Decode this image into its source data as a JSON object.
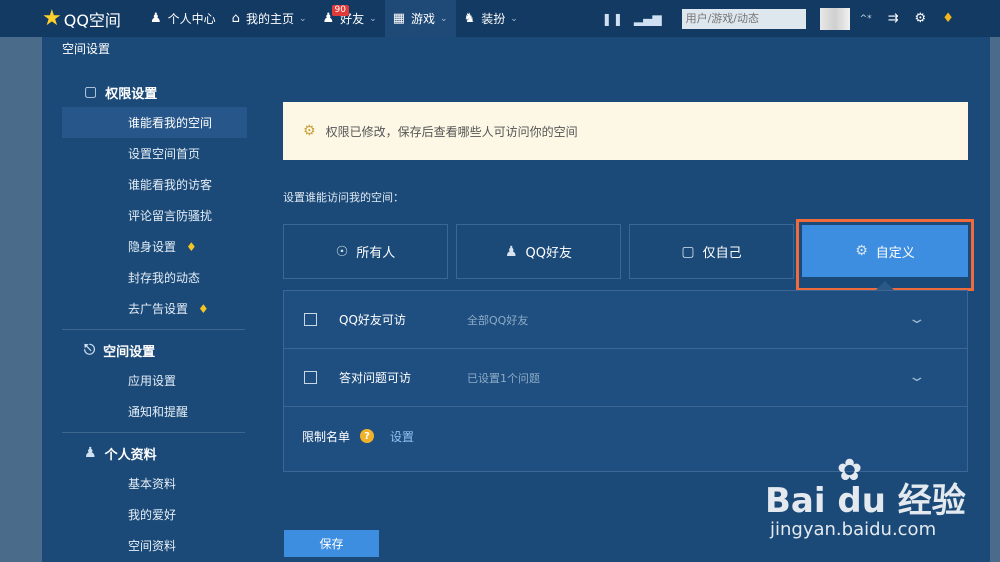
{
  "topbar": {
    "logo_text": "QQ空间",
    "nav": [
      {
        "label": "个人中心",
        "icon": "user-icon"
      },
      {
        "label": "我的主页",
        "icon": "home-icon"
      },
      {
        "label": "好友",
        "icon": "friends-icon",
        "badge": "90"
      },
      {
        "label": "游戏",
        "icon": "grid-icon"
      },
      {
        "label": "装扮",
        "icon": "shirt-icon"
      }
    ],
    "search_placeholder": "用户/游戏/动态",
    "caret_text": "^*"
  },
  "panel": {
    "title": "空间设置"
  },
  "sidebar": {
    "sections": [
      {
        "title": "权限设置",
        "icon": "lock-icon",
        "items": [
          "谁能看我的空间",
          "设置空间首页",
          "谁能看我的访客",
          "评论留言防骚扰",
          "隐身设置",
          "封存我的动态",
          "去广告设置"
        ]
      },
      {
        "title": "空间设置",
        "icon": "space-settings-icon",
        "items": [
          "应用设置",
          "通知和提醒"
        ]
      },
      {
        "title": "个人资料",
        "icon": "profile-icon",
        "items": [
          "基本资料",
          "我的爱好",
          "空间资料"
        ]
      }
    ]
  },
  "content": {
    "notice": "权限已修改，保存后查看哪些人可访问你的空间",
    "access_label": "设置谁能访问我的空间：",
    "options": [
      "所有人",
      "QQ好友",
      "仅自己",
      "自定义"
    ],
    "selected_option": "自定义",
    "rows": [
      {
        "label": "QQ好友可访",
        "desc": "全部QQ好友"
      },
      {
        "label": "答对问题可访",
        "desc": "已设置1个问题"
      }
    ],
    "limit": {
      "label": "限制名单",
      "help": "?",
      "link": "设置"
    },
    "save_label": "保存"
  },
  "watermark": {
    "brand": "Bai du 经验",
    "sub": "jingyan.baidu.com"
  },
  "colors": {
    "topbar": "#123a63",
    "panel": "#1b4a78",
    "accent": "#3d8ee0",
    "highlight": "#ef6b3b",
    "notice_bg": "#fcf8e5",
    "vip": "#f3c623"
  }
}
